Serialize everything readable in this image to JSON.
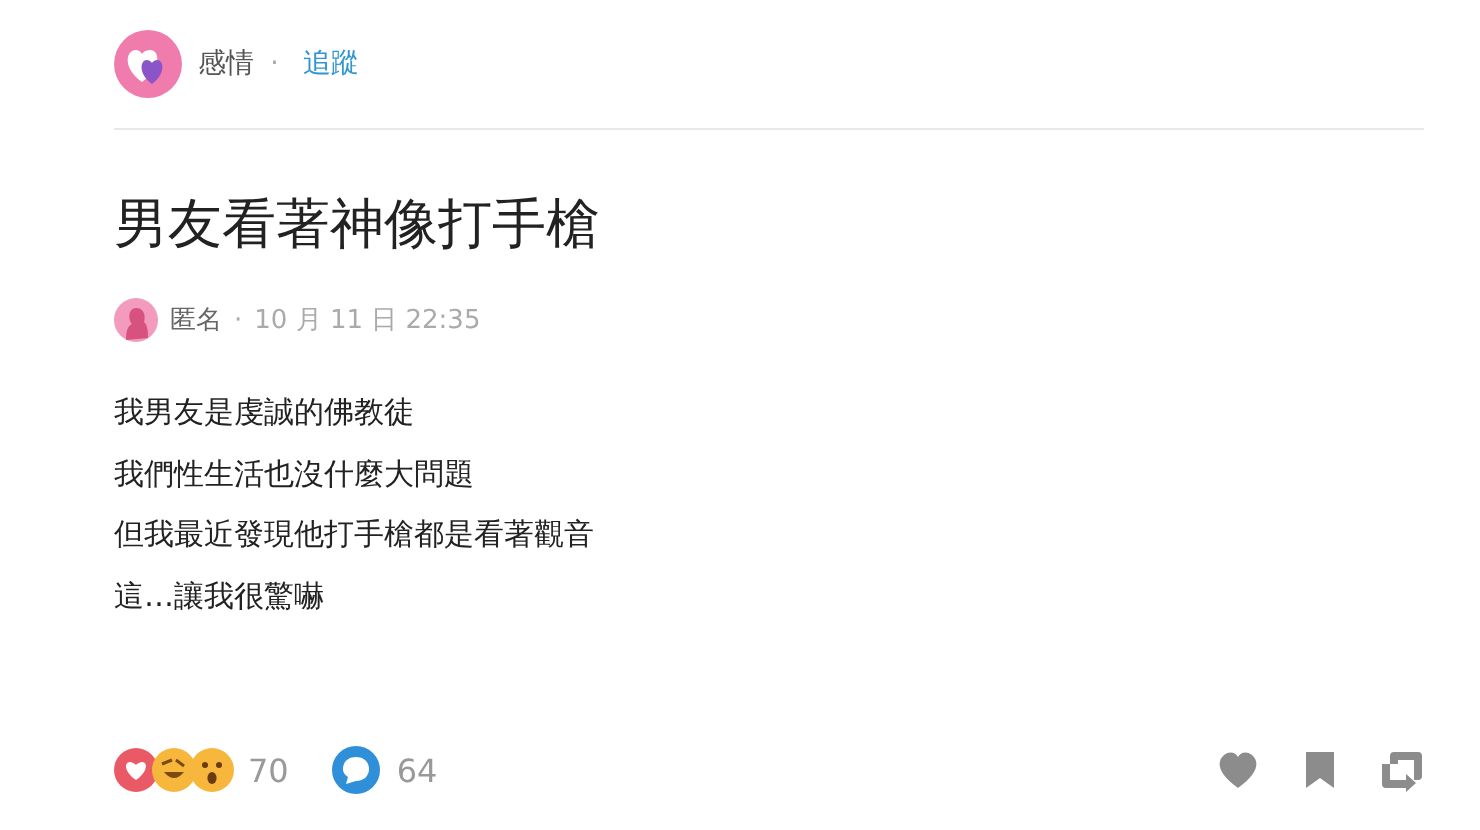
{
  "board": {
    "name": "感情",
    "separator": "·",
    "follow_link": "追蹤"
  },
  "post": {
    "title": "男友看著神像打手槍",
    "author": "匿名",
    "separator": "·",
    "date": "10 月 11 日 22:35",
    "body": [
      "我男友是虔誠的佛教徒",
      "我們性生活也沒什麼大問題",
      "但我最近發現他打手槍都是看著觀音",
      "這…讓我很驚嚇"
    ]
  },
  "footer": {
    "reaction_count": "70",
    "comment_count": "64"
  }
}
